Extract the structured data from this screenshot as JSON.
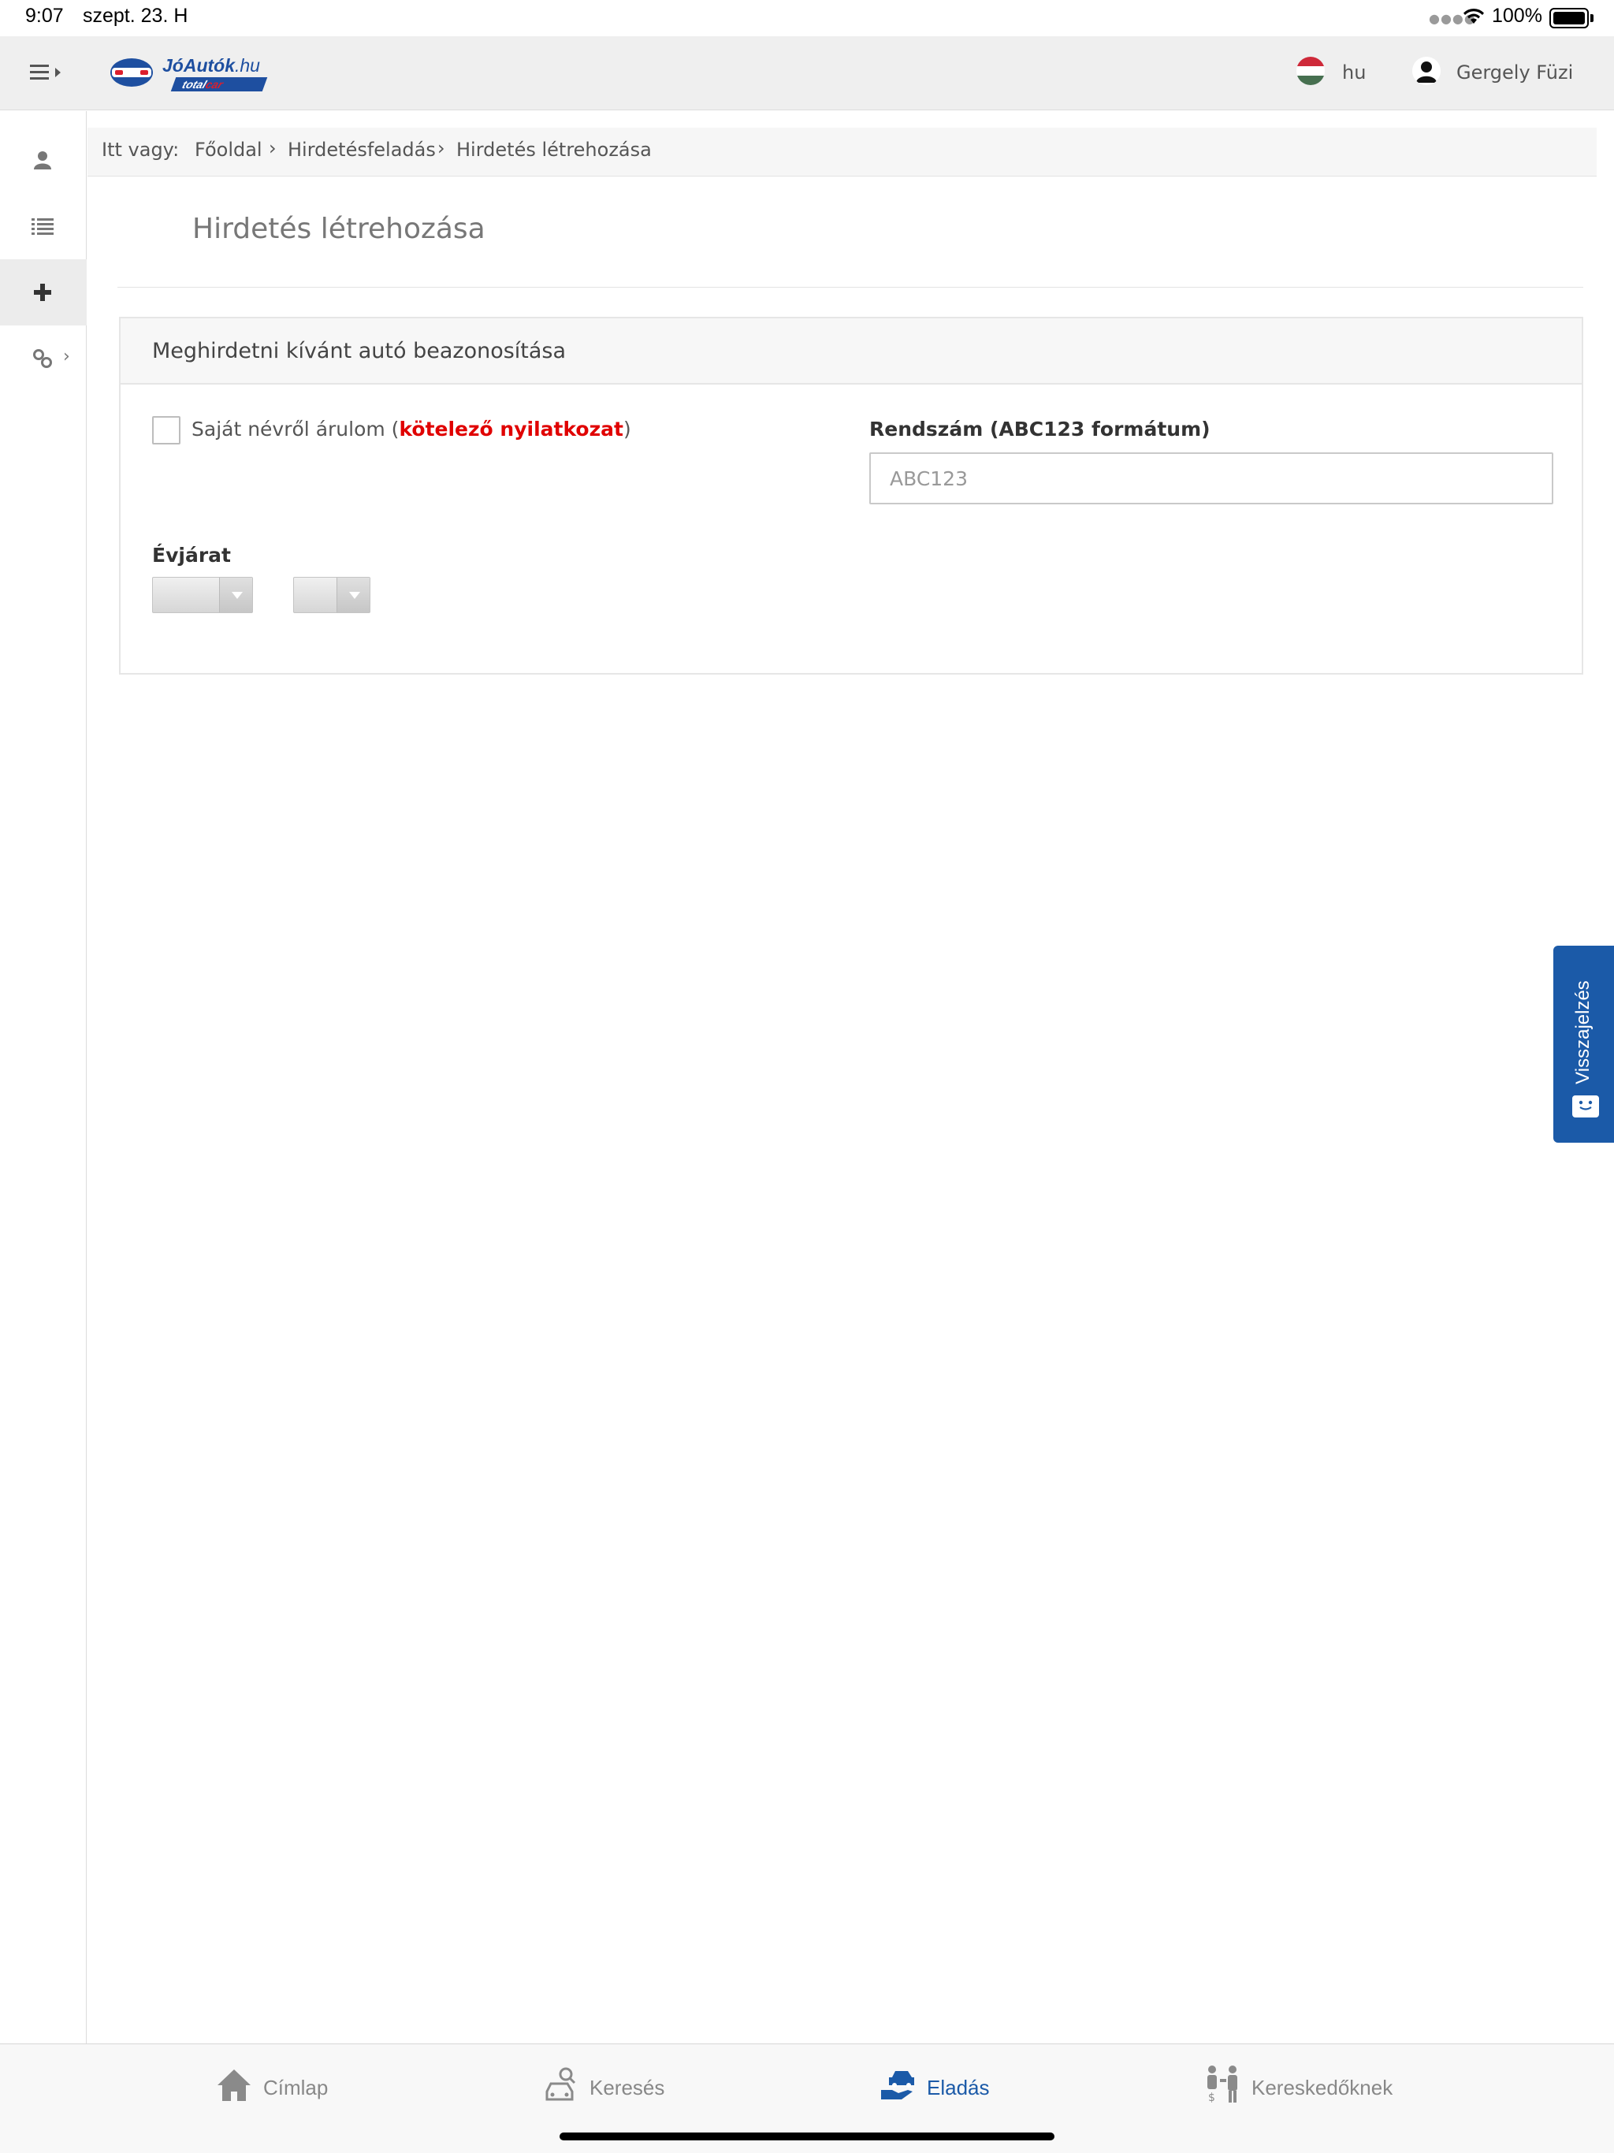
{
  "status_bar": {
    "time": "9:07",
    "date": "szept. 23. H",
    "battery": "100%"
  },
  "header": {
    "logo": {
      "main": "JóAutók",
      "suffix": ".hu",
      "sub_left": "total",
      "sub_right": "car"
    },
    "language": "hu",
    "user_name": "Gergely Füzi"
  },
  "breadcrumb": {
    "prefix": "Itt vagy:",
    "items": [
      "Főoldal",
      "Hirdetésfeladás",
      "Hirdetés létrehozása"
    ]
  },
  "page_title": "Hirdetés létrehozása",
  "panel": {
    "title": "Meghirdetni kívánt autó beazonosítása",
    "own_name_checkbox": {
      "label_before": "Saját névről árulom (",
      "label_required": "kötelező nyilatkozat",
      "label_after": ")",
      "checked": false
    },
    "plate": {
      "label": "Rendszám (ABC123 formátum)",
      "placeholder": "ABC123",
      "value": ""
    },
    "year": {
      "label": "Évjárat",
      "year_value": "",
      "month_value": ""
    }
  },
  "feedback_tab": {
    "label": "Visszajelzés"
  },
  "tabbar": {
    "tabs": [
      {
        "label": "Címlap",
        "icon": "home-icon",
        "active": false
      },
      {
        "label": "Keresés",
        "icon": "car-search-icon",
        "active": false
      },
      {
        "label": "Eladás",
        "icon": "car-sell-icon",
        "active": true
      },
      {
        "label": "Kereskedőknek",
        "icon": "dealer-icon",
        "active": false
      }
    ]
  },
  "colors": {
    "accent": "#1b5aa8",
    "required": "#e00000",
    "logo_blue": "#1e4fa0",
    "logo_red": "#dc1f2d"
  }
}
